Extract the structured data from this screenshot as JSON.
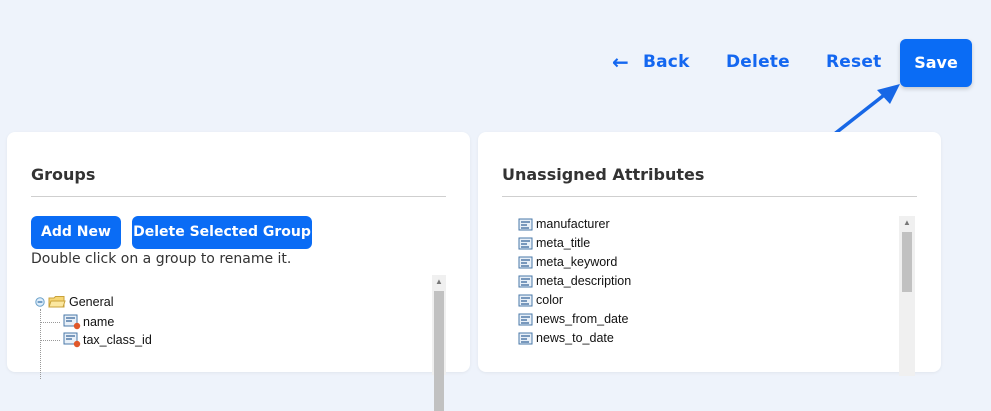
{
  "toolbar": {
    "back_label": "Back",
    "delete_label": "Delete",
    "reset_label": "Reset",
    "save_label": "Save"
  },
  "groups_panel": {
    "title": "Groups",
    "add_new_label": "Add New",
    "delete_group_label": "Delete Selected Group",
    "hint": "Double click on a group to rename it.",
    "tree": {
      "group": "General",
      "children": [
        "name",
        "tax_class_id"
      ]
    }
  },
  "unassigned_panel": {
    "title": "Unassigned Attributes",
    "items": [
      "manufacturer",
      "meta_title",
      "meta_keyword",
      "meta_description",
      "color",
      "news_from_date",
      "news_to_date"
    ]
  },
  "colors": {
    "accent": "#0a6cf5",
    "background": "#eef3fb"
  }
}
